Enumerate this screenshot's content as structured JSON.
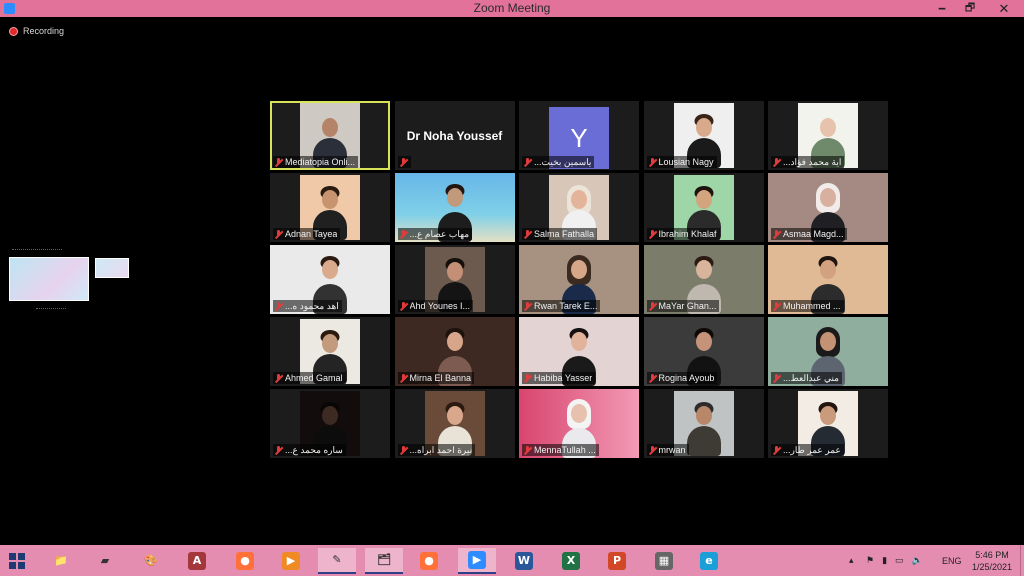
{
  "window": {
    "title": "Zoom Meeting",
    "min_glyph": "🗕",
    "max_glyph": "🗗",
    "close_glyph": "✕",
    "titlebar_color": "#e2729a"
  },
  "recording": {
    "label": "Recording",
    "dot_color": "#e02929"
  },
  "participants": [
    {
      "name": "Mediatopia Onli...",
      "active": true
    },
    {
      "name": "Dr Noha Youssef",
      "type": "name-only"
    },
    {
      "name": "...ياسمين بخيت",
      "avatar_letter": "Y",
      "avatar_color": "#6a6dd6"
    },
    {
      "name": "Lousian Nagy"
    },
    {
      "name": "...اية محمد فؤاد"
    },
    {
      "name": "Adnan Tayea"
    },
    {
      "name": "...مهاب عصام ع"
    },
    {
      "name": "Salma Fathalla"
    },
    {
      "name": "Ibrahim Khalaf"
    },
    {
      "name": "Asmaa Magd..."
    },
    {
      "name": "...اهد محمود ه"
    },
    {
      "name": "Ahd Younes I..."
    },
    {
      "name": "Rwan Tarek E..."
    },
    {
      "name": "MaYar Ghan..."
    },
    {
      "name": "Muhammed ..."
    },
    {
      "name": "Ahmed Gamal"
    },
    {
      "name": "Mirna El Banna"
    },
    {
      "name": "Habiba Yasser"
    },
    {
      "name": "Rogina Ayoub"
    },
    {
      "name": "...مني عبدالعط"
    },
    {
      "name": "...ساره محمد ع"
    },
    {
      "name": "...نيرة احمد ابراه"
    },
    {
      "name": "MennaTullah ..."
    },
    {
      "name": "mrwan"
    },
    {
      "name": "...عمر عمر طار"
    }
  ],
  "taskbar": {
    "apps": [
      {
        "icon": "folder-note-icon",
        "glyph": "📁",
        "open": false
      },
      {
        "icon": "tablet-icon",
        "glyph": "▰",
        "open": false
      },
      {
        "icon": "paint-icon",
        "glyph": "🎨",
        "open": false
      },
      {
        "icon": "access-icon",
        "glyph": "A",
        "color": "#a4373a",
        "open": false
      },
      {
        "icon": "firefox-icon",
        "glyph": "●",
        "color": "#ff7139",
        "open": false
      },
      {
        "icon": "media-player-icon",
        "glyph": "▶",
        "color": "#f08a24",
        "open": false
      },
      {
        "icon": "paint-3d-icon",
        "glyph": "✎",
        "open": true
      },
      {
        "icon": "file-explorer-icon",
        "glyph": "🗂",
        "open": true
      },
      {
        "icon": "firefox-icon-2",
        "glyph": "●",
        "color": "#ff7139",
        "open": false
      },
      {
        "icon": "zoom-icon",
        "glyph": "▶",
        "color": "#2d8cff",
        "open": true
      },
      {
        "icon": "word-icon",
        "glyph": "W",
        "color": "#2b579a",
        "open": false
      },
      {
        "icon": "excel-icon",
        "glyph": "X",
        "color": "#217346",
        "open": false
      },
      {
        "icon": "powerpoint-icon",
        "glyph": "P",
        "color": "#d24726",
        "open": false
      },
      {
        "icon": "calculator-icon",
        "glyph": "▦",
        "color": "#666666",
        "open": false
      },
      {
        "icon": "edge-icon",
        "glyph": "e",
        "color": "#1a9fd9",
        "open": false
      }
    ],
    "tray_chevron": "▴",
    "language": "ENG",
    "time": "5:46 PM",
    "date": "1/25/2021"
  }
}
